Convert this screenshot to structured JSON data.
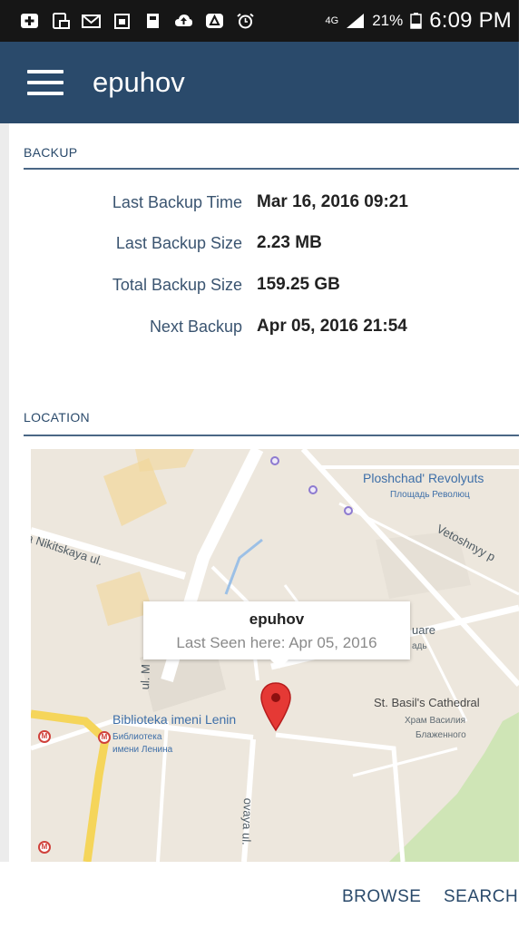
{
  "status_bar": {
    "network": "4G",
    "battery_percent": "21%",
    "time": "6:09 PM"
  },
  "app_bar": {
    "title": "epuhov"
  },
  "backup": {
    "header": "BACKUP",
    "rows": [
      {
        "label": "Last Backup Time",
        "value": "Mar 16, 2016 09:21"
      },
      {
        "label": "Last Backup Size",
        "value": "2.23 MB"
      },
      {
        "label": "Total Backup Size",
        "value": "159.25 GB"
      },
      {
        "label": "Next Backup",
        "value": "Apr 05, 2016 21:54"
      }
    ]
  },
  "location": {
    "header": "LOCATION",
    "map": {
      "labels": {
        "ploshchad_en": "Ploshchad' Revolyuts",
        "ploshchad_ru": "Площадь Революц",
        "nikitskaya": "a Nikitskaya ul.",
        "vetoshnyy": "Vetoshnyy p",
        "square": "uare",
        "square_ru": "адь",
        "basil_en": "St. Basil's Cathedral",
        "basil_ru1": "Храм Василия",
        "basil_ru2": "Блаженного",
        "library_en": "Biblioteka imeni Lenin",
        "library_ru1": "Библиотека",
        "library_ru2": "имени Ленина",
        "street_m": "ul. M",
        "street_vaya": "ovaya ul."
      },
      "info_window": {
        "title": "epuhov",
        "subtitle": "Last Seen here: Apr 05, 2016"
      },
      "metro_symbol": "M"
    }
  },
  "bottom_bar": {
    "browse_label": "BROWSE",
    "search_label": "SEARCH"
  },
  "colors": {
    "app_bar": "#2a4a6b",
    "status_bar": "#161616",
    "accent_text": "#2a4a6b",
    "pin": "#e53935"
  }
}
